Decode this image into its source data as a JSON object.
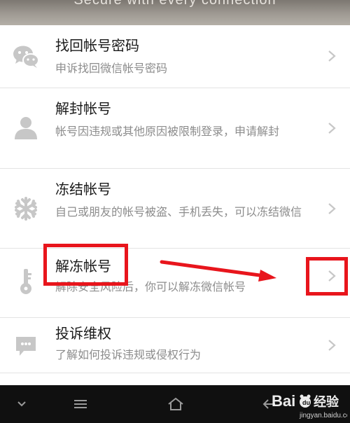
{
  "banner": {
    "text": "Secure with every connection"
  },
  "items": [
    {
      "title": "找回帐号密码",
      "desc": "申诉找回微信帐号密码",
      "icon": "wechat-icon"
    },
    {
      "title": "解封帐号",
      "desc": "帐号因违规或其他原因被限制登录，申请解封",
      "icon": "person-icon"
    },
    {
      "title": "冻结帐号",
      "desc": "自己或朋友的帐号被盗、手机丢失，可以冻结微信",
      "icon": "snowflake-icon"
    },
    {
      "title": "解冻帐号",
      "desc": "解除安全风险后，你可以解冻微信帐号",
      "icon": "key-icon"
    },
    {
      "title": "投诉维权",
      "desc": "了解如何投诉违规或侵权行为",
      "icon": "complaint-bubble-icon"
    }
  ],
  "navbar": {
    "icons": [
      "chevron-down-icon",
      "menu-icon",
      "home-icon",
      "back-icon"
    ]
  },
  "watermark": {
    "logo_text": "Bai du 经验",
    "url": "jingyan.baidu.com"
  },
  "colors": {
    "icon_gray": "#c7c7c7",
    "annotation_red": "#e8151c",
    "navbar_bg": "#101010"
  }
}
